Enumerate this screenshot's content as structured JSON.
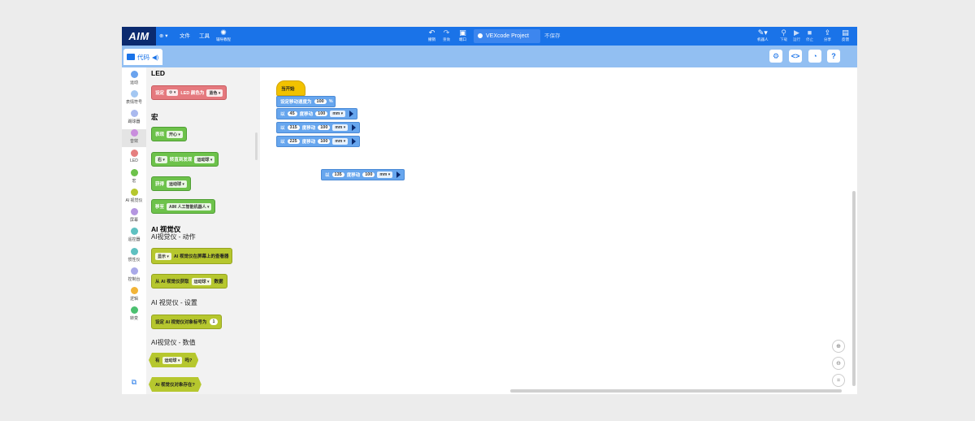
{
  "topbar": {
    "logo": "AIM",
    "globe": "⊕ ▾",
    "file": "文件",
    "tools": "工具",
    "tutorial": "辅导教程",
    "undo": "撤销",
    "redo": "重做",
    "device": "端口",
    "project_name": "VEXcode Project",
    "save_status": "不保存",
    "robot": "机器人",
    "download": "下载",
    "run": "运行",
    "stop": "停止",
    "share": "分享",
    "feedback": "反馈"
  },
  "subbar": {
    "code_tab": "代码"
  },
  "categories": [
    "运动",
    "表情符号",
    "踢球器",
    "音效",
    "LED",
    "宏",
    "AI 视觉仪",
    "屏幕",
    "遥控器",
    "惯性仪",
    "控制台",
    "逻辑",
    "转变"
  ],
  "category_colors": [
    "#6aa3ee",
    "#a3c7f2",
    "#a9b9ee",
    "#c98ddd",
    "#e57e7e",
    "#6dc24b",
    "#b6c72e",
    "#b596e0",
    "#5fc1c1",
    "#5fc1c1",
    "#a9a9e8",
    "#f2b437",
    "#4cc070"
  ],
  "palette": {
    "led_title": "LED",
    "led_block": {
      "prefix": "设定",
      "mid": "LED 颜色为",
      "color": "蓝色"
    },
    "macro_title": "宏",
    "macro_blocks": [
      {
        "a": "表现",
        "b": "开心"
      },
      {
        "a": "右",
        "b": "转直到发现",
        "c": "运动球"
      },
      {
        "a": "获得",
        "b": "运动球"
      },
      {
        "a": "移至",
        "b": "AIM 人工智能机器人"
      }
    ],
    "ai_title": "AI 视觉仪",
    "ai_actions_title": "AI视觉仪 - 动作",
    "ai_show": {
      "a": "显示",
      "b": "AI 视觉仪在屏幕上的查看器"
    },
    "ai_get": {
      "a": "从 AI 视觉仪获取",
      "b": "运动球",
      "c": "数据"
    },
    "ai_settings_title": "AI 视觉仪 - 设置",
    "ai_set": {
      "a": "设定 AI 视觉仪对象标号为",
      "b": "1"
    },
    "ai_values_title": "AI视觉仪 - 数值",
    "ai_has": {
      "a": "有",
      "b": "运动球",
      "c": "吗?"
    },
    "ai_exists": "AI 视觉仪对象存在?"
  },
  "workspace": {
    "hat": "当开始",
    "speed": {
      "a": "设定移动速度为",
      "b": "100",
      "c": "%"
    },
    "move_label": "以",
    "deg_label": "度移动",
    "unit": "mm",
    "moves": [
      {
        "angle": "45",
        "dist": "100"
      },
      {
        "angle": "315",
        "dist": "100"
      },
      {
        "angle": "225",
        "dist": "100"
      }
    ],
    "loose": {
      "angle": "135",
      "dist": "100"
    }
  }
}
